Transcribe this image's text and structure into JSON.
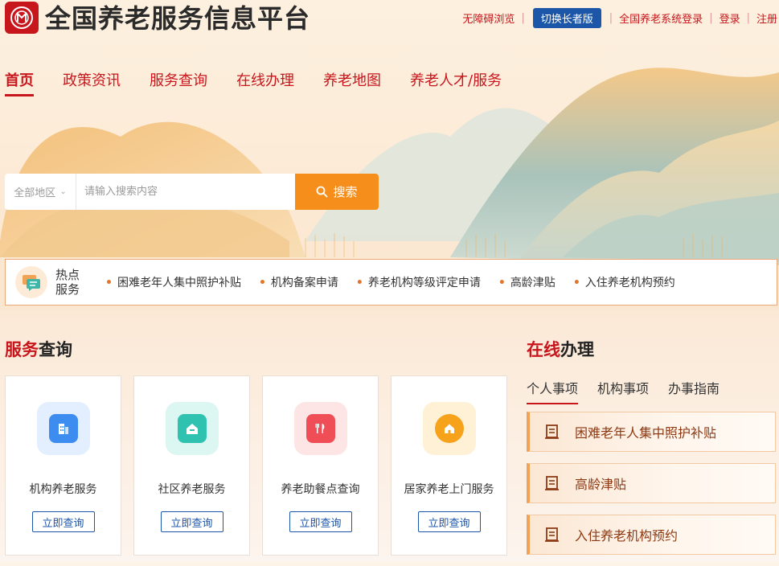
{
  "header": {
    "title": "全国养老服务信息平台",
    "links": {
      "accessibility": "无障碍浏览",
      "elder_mode": "切换长者版",
      "system_login": "全国养老系统登录",
      "login": "登录",
      "register": "注册"
    }
  },
  "nav": {
    "items": [
      {
        "label": "首页"
      },
      {
        "label": "政策资讯"
      },
      {
        "label": "服务查询"
      },
      {
        "label": "在线办理"
      },
      {
        "label": "养老地图"
      },
      {
        "label": "养老人才/服务"
      }
    ]
  },
  "search": {
    "region": "全部地区",
    "placeholder": "请输入搜索内容",
    "button": "搜索"
  },
  "hot": {
    "title": "热点服务",
    "items": [
      "困难老年人集中照护补贴",
      "机构备案申请",
      "养老机构等级评定申请",
      "高龄津贴",
      "入住养老机构预约"
    ]
  },
  "service_query": {
    "title_highlight": "服务",
    "title_rest": "查询",
    "cards": [
      {
        "label": "机构养老服务",
        "button": "立即查询",
        "icon": "building-icon",
        "color": "#3d8cf0"
      },
      {
        "label": "社区养老服务",
        "button": "立即查询",
        "icon": "community-icon",
        "color": "#2fc2b0"
      },
      {
        "label": "养老助餐点查询",
        "button": "立即查询",
        "icon": "meal-icon",
        "color": "#f04e57"
      },
      {
        "label": "居家养老上门服务",
        "button": "立即查询",
        "icon": "home-icon",
        "color": "#f7a21b"
      }
    ]
  },
  "online": {
    "title_highlight": "在线",
    "title_rest": "办理",
    "tabs": [
      {
        "label": "个人事项"
      },
      {
        "label": "机构事项"
      },
      {
        "label": "办事指南"
      }
    ],
    "items": [
      {
        "label": "困难老年人集中照护补贴"
      },
      {
        "label": "高龄津贴"
      },
      {
        "label": "入住养老机构预约"
      }
    ]
  }
}
